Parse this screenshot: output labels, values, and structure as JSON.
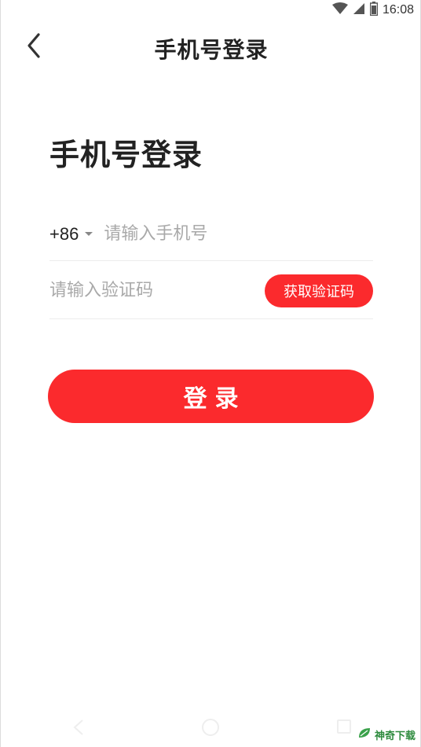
{
  "status_bar": {
    "time": "16:08",
    "icons": [
      "wifi-icon",
      "signal-icon",
      "battery-icon"
    ]
  },
  "header": {
    "title": "手机号登录",
    "back_icon": "chevron-left-icon"
  },
  "main": {
    "page_title": "手机号登录",
    "phone": {
      "country_code": "+86",
      "placeholder": "请输入手机号",
      "value": ""
    },
    "code": {
      "placeholder": "请输入验证码",
      "value": "",
      "get_code_label": "获取验证码"
    },
    "login_label": "登录"
  },
  "watermark": {
    "text": "神奇下载"
  },
  "colors": {
    "accent": "#fb2a2d",
    "text": "#222222",
    "placeholder": "#a9a9a9",
    "divider": "#ececec"
  }
}
